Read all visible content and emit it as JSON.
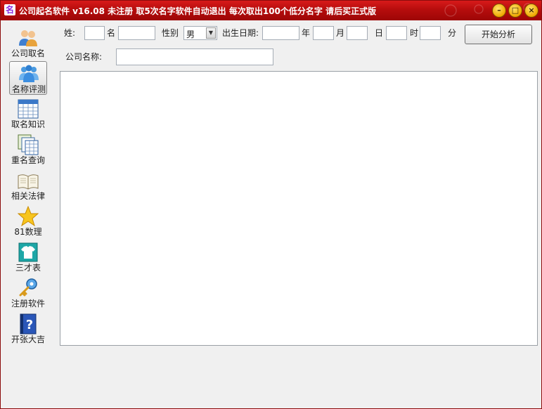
{
  "titlebar": {
    "icon_glyph": "名",
    "title": "公司起名软件 v16.08  未注册  取5次名字软件自动退出 每次取出100个低分名字 请后买正式版"
  },
  "window_controls": {
    "minimize": "–",
    "maximize": "□",
    "close": "×"
  },
  "sidebar": {
    "items": [
      {
        "label": "公司取名",
        "icon": "people-icon"
      },
      {
        "label": "名称评测",
        "icon": "group-icon",
        "selected": true
      },
      {
        "label": "取名知识",
        "icon": "calendar-grid-icon"
      },
      {
        "label": "重名查询",
        "icon": "stacked-documents-icon"
      },
      {
        "label": "相关法律",
        "icon": "open-book-icon"
      },
      {
        "label": "81数理",
        "icon": "star-icon"
      },
      {
        "label": "三才表",
        "icon": "shirt-icon"
      },
      {
        "label": "注册软件",
        "icon": "key-icon"
      },
      {
        "label": "开张大吉",
        "icon": "help-book-icon"
      }
    ]
  },
  "form": {
    "surname_label": "姓:",
    "surname_value": "",
    "name_label": "名",
    "name_value": "",
    "gender_label": "性别",
    "gender_value": "男",
    "birthdate_label": "出生日期:",
    "year_label": "年",
    "month_label": "月",
    "day_label": "日",
    "hour_label": "时",
    "minute_label": "分",
    "analyze_button": "开始分析",
    "company_name_label": "公司名称:",
    "company_name_value": ""
  },
  "results": {
    "text": ""
  }
}
